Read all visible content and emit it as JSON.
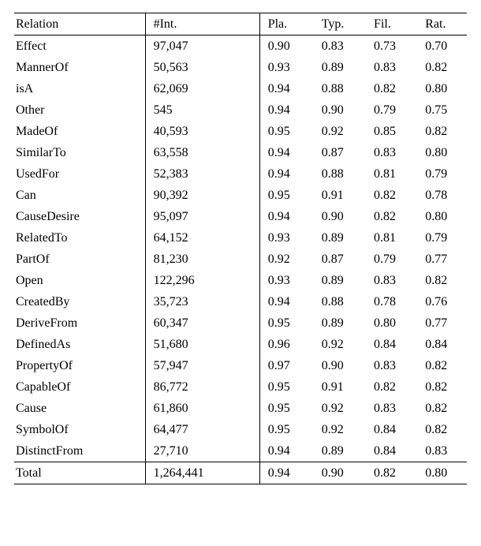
{
  "chart_data": {
    "type": "table",
    "columns": [
      "Relation",
      "#Int.",
      "Pla.",
      "Typ.",
      "Fil.",
      "Rat."
    ],
    "rows": [
      {
        "relation": "Effect",
        "int": "97,047",
        "pla": "0.90",
        "typ": "0.83",
        "fil": "0.73",
        "rat": "0.70"
      },
      {
        "relation": "MannerOf",
        "int": "50,563",
        "pla": "0.93",
        "typ": "0.89",
        "fil": "0.83",
        "rat": "0.82"
      },
      {
        "relation": "isA",
        "int": "62,069",
        "pla": "0.94",
        "typ": "0.88",
        "fil": "0.82",
        "rat": "0.80"
      },
      {
        "relation": "Other",
        "int": "545",
        "pla": "0.94",
        "typ": "0.90",
        "fil": "0.79",
        "rat": "0.75"
      },
      {
        "relation": "MadeOf",
        "int": "40,593",
        "pla": "0.95",
        "typ": "0.92",
        "fil": "0.85",
        "rat": "0.82"
      },
      {
        "relation": "SimilarTo",
        "int": "63,558",
        "pla": "0.94",
        "typ": "0.87",
        "fil": "0.83",
        "rat": "0.80"
      },
      {
        "relation": "UsedFor",
        "int": "52,383",
        "pla": "0.94",
        "typ": "0.88",
        "fil": "0.81",
        "rat": "0.79"
      },
      {
        "relation": "Can",
        "int": "90,392",
        "pla": "0.95",
        "typ": "0.91",
        "fil": "0.82",
        "rat": "0.78"
      },
      {
        "relation": "CauseDesire",
        "int": "95,097",
        "pla": "0.94",
        "typ": "0.90",
        "fil": "0.82",
        "rat": "0.80"
      },
      {
        "relation": "RelatedTo",
        "int": "64,152",
        "pla": "0.93",
        "typ": "0.89",
        "fil": "0.81",
        "rat": "0.79"
      },
      {
        "relation": "PartOf",
        "int": "81,230",
        "pla": "0.92",
        "typ": "0.87",
        "fil": "0.79",
        "rat": "0.77"
      },
      {
        "relation": "Open",
        "int": "122,296",
        "pla": "0.93",
        "typ": "0.89",
        "fil": "0.83",
        "rat": "0.82"
      },
      {
        "relation": "CreatedBy",
        "int": "35,723",
        "pla": "0.94",
        "typ": "0.88",
        "fil": "0.78",
        "rat": "0.76"
      },
      {
        "relation": "DeriveFrom",
        "int": "60,347",
        "pla": "0.95",
        "typ": "0.89",
        "fil": "0.80",
        "rat": "0.77"
      },
      {
        "relation": "DefinedAs",
        "int": "51,680",
        "pla": "0.96",
        "typ": "0.92",
        "fil": "0.84",
        "rat": "0.84"
      },
      {
        "relation": "PropertyOf",
        "int": "57,947",
        "pla": "0.97",
        "typ": "0.90",
        "fil": "0.83",
        "rat": "0.82"
      },
      {
        "relation": "CapableOf",
        "int": "86,772",
        "pla": "0.95",
        "typ": "0.91",
        "fil": "0.82",
        "rat": "0.82"
      },
      {
        "relation": "Cause",
        "int": "61,860",
        "pla": "0.95",
        "typ": "0.92",
        "fil": "0.83",
        "rat": "0.82"
      },
      {
        "relation": "SymbolOf",
        "int": "64,477",
        "pla": "0.95",
        "typ": "0.92",
        "fil": "0.84",
        "rat": "0.82"
      },
      {
        "relation": "DistinctFrom",
        "int": "27,710",
        "pla": "0.94",
        "typ": "0.89",
        "fil": "0.84",
        "rat": "0.83"
      }
    ],
    "total": {
      "relation": "Total",
      "int": "1,264,441",
      "pla": "0.94",
      "typ": "0.90",
      "fil": "0.82",
      "rat": "0.80"
    }
  }
}
